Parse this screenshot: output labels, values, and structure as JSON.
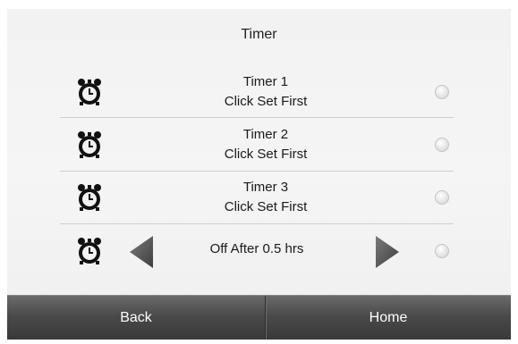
{
  "header": {
    "title": "Timer"
  },
  "timers": [
    {
      "name": "Timer 1",
      "status": "Click Set First",
      "icon": "alarm-clock-icon"
    },
    {
      "name": "Timer 2",
      "status": "Click Set First",
      "icon": "alarm-clock-icon"
    },
    {
      "name": "Timer 3",
      "status": "Click Set First",
      "icon": "alarm-clock-icon"
    }
  ],
  "off_timer": {
    "label": "Off After 0.5 hrs",
    "icon": "alarm-clock-icon"
  },
  "footer": {
    "back_label": "Back",
    "home_label": "Home"
  },
  "colors": {
    "arrow": "#5c5c5c",
    "bar": "#4a4a4a",
    "text": "#1a1a1a"
  }
}
